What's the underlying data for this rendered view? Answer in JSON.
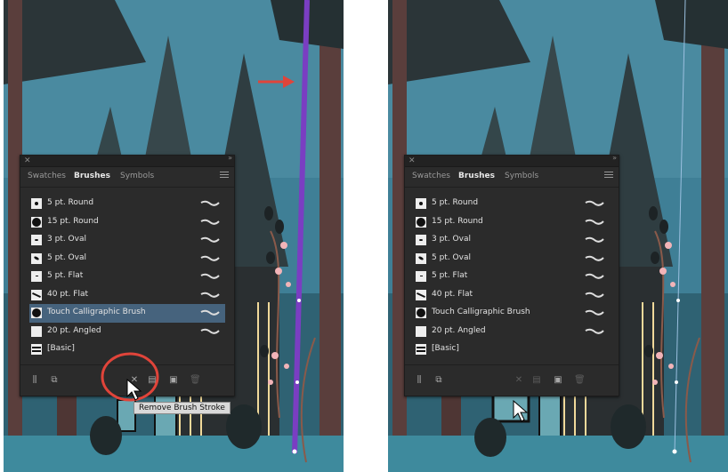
{
  "left_screenshot": {
    "panel": {
      "tabs": [
        "Swatches",
        "Brushes",
        "Symbols"
      ],
      "active_tab": "Brushes",
      "brushes": [
        {
          "label": "5 pt. Round",
          "icon": "dot-small-icon",
          "selected": false
        },
        {
          "label": "15 pt. Round",
          "icon": "dot-large-icon",
          "selected": false
        },
        {
          "label": "3 pt. Oval",
          "icon": "oval-small-icon",
          "selected": false
        },
        {
          "label": "5 pt. Oval",
          "icon": "oval-icon",
          "selected": false
        },
        {
          "label": "5 pt. Flat",
          "icon": "flat-icon",
          "selected": false
        },
        {
          "label": "40 pt. Flat",
          "icon": "flat-angled-icon",
          "selected": false
        },
        {
          "label": "Touch Calligraphic Brush",
          "icon": "calligraphic-icon",
          "selected": true
        },
        {
          "label": "20 pt. Angled",
          "icon": "angled-icon",
          "selected": false
        },
        {
          "label": "[Basic]",
          "icon": "basic-lines-icon",
          "selected": false
        }
      ]
    },
    "tooltip": "Remove Brush Stroke",
    "stroke_color": "#7a3ec2",
    "callout_color": "#e0443a"
  },
  "right_screenshot": {
    "panel": {
      "tabs": [
        "Swatches",
        "Brushes",
        "Symbols"
      ],
      "active_tab": "Brushes",
      "brushes": [
        {
          "label": "5 pt. Round",
          "icon": "dot-small-icon",
          "selected": false
        },
        {
          "label": "15 pt. Round",
          "icon": "dot-large-icon",
          "selected": false
        },
        {
          "label": "3 pt. Oval",
          "icon": "oval-small-icon",
          "selected": false
        },
        {
          "label": "5 pt. Oval",
          "icon": "oval-icon",
          "selected": false
        },
        {
          "label": "5 pt. Flat",
          "icon": "flat-icon",
          "selected": false
        },
        {
          "label": "40 pt. Flat",
          "icon": "flat-angled-icon",
          "selected": false
        },
        {
          "label": "Touch Calligraphic Brush",
          "icon": "calligraphic-icon",
          "selected": false
        },
        {
          "label": "20 pt. Angled",
          "icon": "angled-icon",
          "selected": false
        },
        {
          "label": "[Basic]",
          "icon": "basic-lines-icon",
          "selected": false
        }
      ]
    },
    "stroke_color": "#9bc0e0"
  },
  "colors": {
    "sky": "#3f7f96",
    "tree_dark": "#2d3a3e",
    "trunk": "#5a3e3c",
    "blossom": "#f2b4b8",
    "panel_bg": "#2b2b2b",
    "selection": "#46637d"
  }
}
